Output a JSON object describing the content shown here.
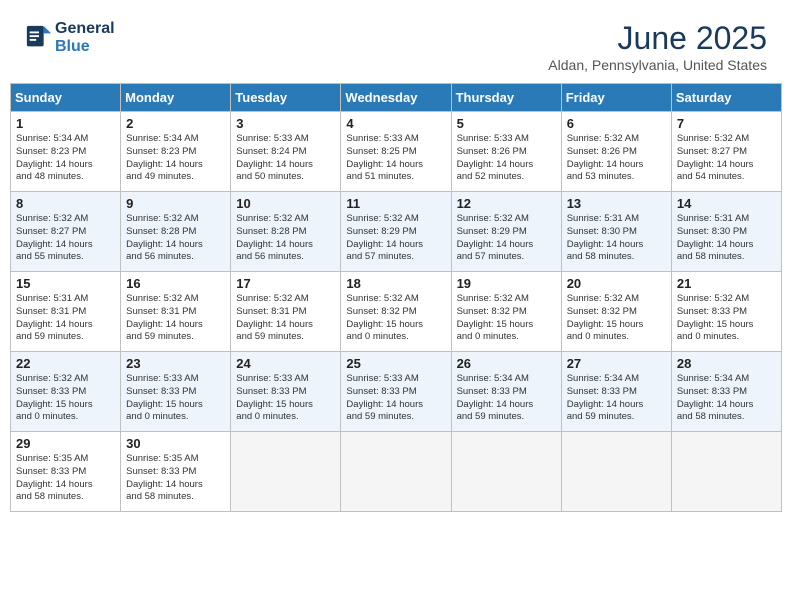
{
  "header": {
    "logo_line1": "General",
    "logo_line2": "Blue",
    "month": "June 2025",
    "location": "Aldan, Pennsylvania, United States"
  },
  "days_of_week": [
    "Sunday",
    "Monday",
    "Tuesday",
    "Wednesday",
    "Thursday",
    "Friday",
    "Saturday"
  ],
  "weeks": [
    [
      {
        "day": "1",
        "info": "Sunrise: 5:34 AM\nSunset: 8:23 PM\nDaylight: 14 hours\nand 48 minutes."
      },
      {
        "day": "2",
        "info": "Sunrise: 5:34 AM\nSunset: 8:23 PM\nDaylight: 14 hours\nand 49 minutes."
      },
      {
        "day": "3",
        "info": "Sunrise: 5:33 AM\nSunset: 8:24 PM\nDaylight: 14 hours\nand 50 minutes."
      },
      {
        "day": "4",
        "info": "Sunrise: 5:33 AM\nSunset: 8:25 PM\nDaylight: 14 hours\nand 51 minutes."
      },
      {
        "day": "5",
        "info": "Sunrise: 5:33 AM\nSunset: 8:26 PM\nDaylight: 14 hours\nand 52 minutes."
      },
      {
        "day": "6",
        "info": "Sunrise: 5:32 AM\nSunset: 8:26 PM\nDaylight: 14 hours\nand 53 minutes."
      },
      {
        "day": "7",
        "info": "Sunrise: 5:32 AM\nSunset: 8:27 PM\nDaylight: 14 hours\nand 54 minutes."
      }
    ],
    [
      {
        "day": "8",
        "info": "Sunrise: 5:32 AM\nSunset: 8:27 PM\nDaylight: 14 hours\nand 55 minutes."
      },
      {
        "day": "9",
        "info": "Sunrise: 5:32 AM\nSunset: 8:28 PM\nDaylight: 14 hours\nand 56 minutes."
      },
      {
        "day": "10",
        "info": "Sunrise: 5:32 AM\nSunset: 8:28 PM\nDaylight: 14 hours\nand 56 minutes."
      },
      {
        "day": "11",
        "info": "Sunrise: 5:32 AM\nSunset: 8:29 PM\nDaylight: 14 hours\nand 57 minutes."
      },
      {
        "day": "12",
        "info": "Sunrise: 5:32 AM\nSunset: 8:29 PM\nDaylight: 14 hours\nand 57 minutes."
      },
      {
        "day": "13",
        "info": "Sunrise: 5:31 AM\nSunset: 8:30 PM\nDaylight: 14 hours\nand 58 minutes."
      },
      {
        "day": "14",
        "info": "Sunrise: 5:31 AM\nSunset: 8:30 PM\nDaylight: 14 hours\nand 58 minutes."
      }
    ],
    [
      {
        "day": "15",
        "info": "Sunrise: 5:31 AM\nSunset: 8:31 PM\nDaylight: 14 hours\nand 59 minutes."
      },
      {
        "day": "16",
        "info": "Sunrise: 5:32 AM\nSunset: 8:31 PM\nDaylight: 14 hours\nand 59 minutes."
      },
      {
        "day": "17",
        "info": "Sunrise: 5:32 AM\nSunset: 8:31 PM\nDaylight: 14 hours\nand 59 minutes."
      },
      {
        "day": "18",
        "info": "Sunrise: 5:32 AM\nSunset: 8:32 PM\nDaylight: 15 hours\nand 0 minutes."
      },
      {
        "day": "19",
        "info": "Sunrise: 5:32 AM\nSunset: 8:32 PM\nDaylight: 15 hours\nand 0 minutes."
      },
      {
        "day": "20",
        "info": "Sunrise: 5:32 AM\nSunset: 8:32 PM\nDaylight: 15 hours\nand 0 minutes."
      },
      {
        "day": "21",
        "info": "Sunrise: 5:32 AM\nSunset: 8:33 PM\nDaylight: 15 hours\nand 0 minutes."
      }
    ],
    [
      {
        "day": "22",
        "info": "Sunrise: 5:32 AM\nSunset: 8:33 PM\nDaylight: 15 hours\nand 0 minutes."
      },
      {
        "day": "23",
        "info": "Sunrise: 5:33 AM\nSunset: 8:33 PM\nDaylight: 15 hours\nand 0 minutes."
      },
      {
        "day": "24",
        "info": "Sunrise: 5:33 AM\nSunset: 8:33 PM\nDaylight: 15 hours\nand 0 minutes."
      },
      {
        "day": "25",
        "info": "Sunrise: 5:33 AM\nSunset: 8:33 PM\nDaylight: 14 hours\nand 59 minutes."
      },
      {
        "day": "26",
        "info": "Sunrise: 5:34 AM\nSunset: 8:33 PM\nDaylight: 14 hours\nand 59 minutes."
      },
      {
        "day": "27",
        "info": "Sunrise: 5:34 AM\nSunset: 8:33 PM\nDaylight: 14 hours\nand 59 minutes."
      },
      {
        "day": "28",
        "info": "Sunrise: 5:34 AM\nSunset: 8:33 PM\nDaylight: 14 hours\nand 58 minutes."
      }
    ],
    [
      {
        "day": "29",
        "info": "Sunrise: 5:35 AM\nSunset: 8:33 PM\nDaylight: 14 hours\nand 58 minutes."
      },
      {
        "day": "30",
        "info": "Sunrise: 5:35 AM\nSunset: 8:33 PM\nDaylight: 14 hours\nand 58 minutes."
      },
      {
        "day": "",
        "info": ""
      },
      {
        "day": "",
        "info": ""
      },
      {
        "day": "",
        "info": ""
      },
      {
        "day": "",
        "info": ""
      },
      {
        "day": "",
        "info": ""
      }
    ]
  ]
}
